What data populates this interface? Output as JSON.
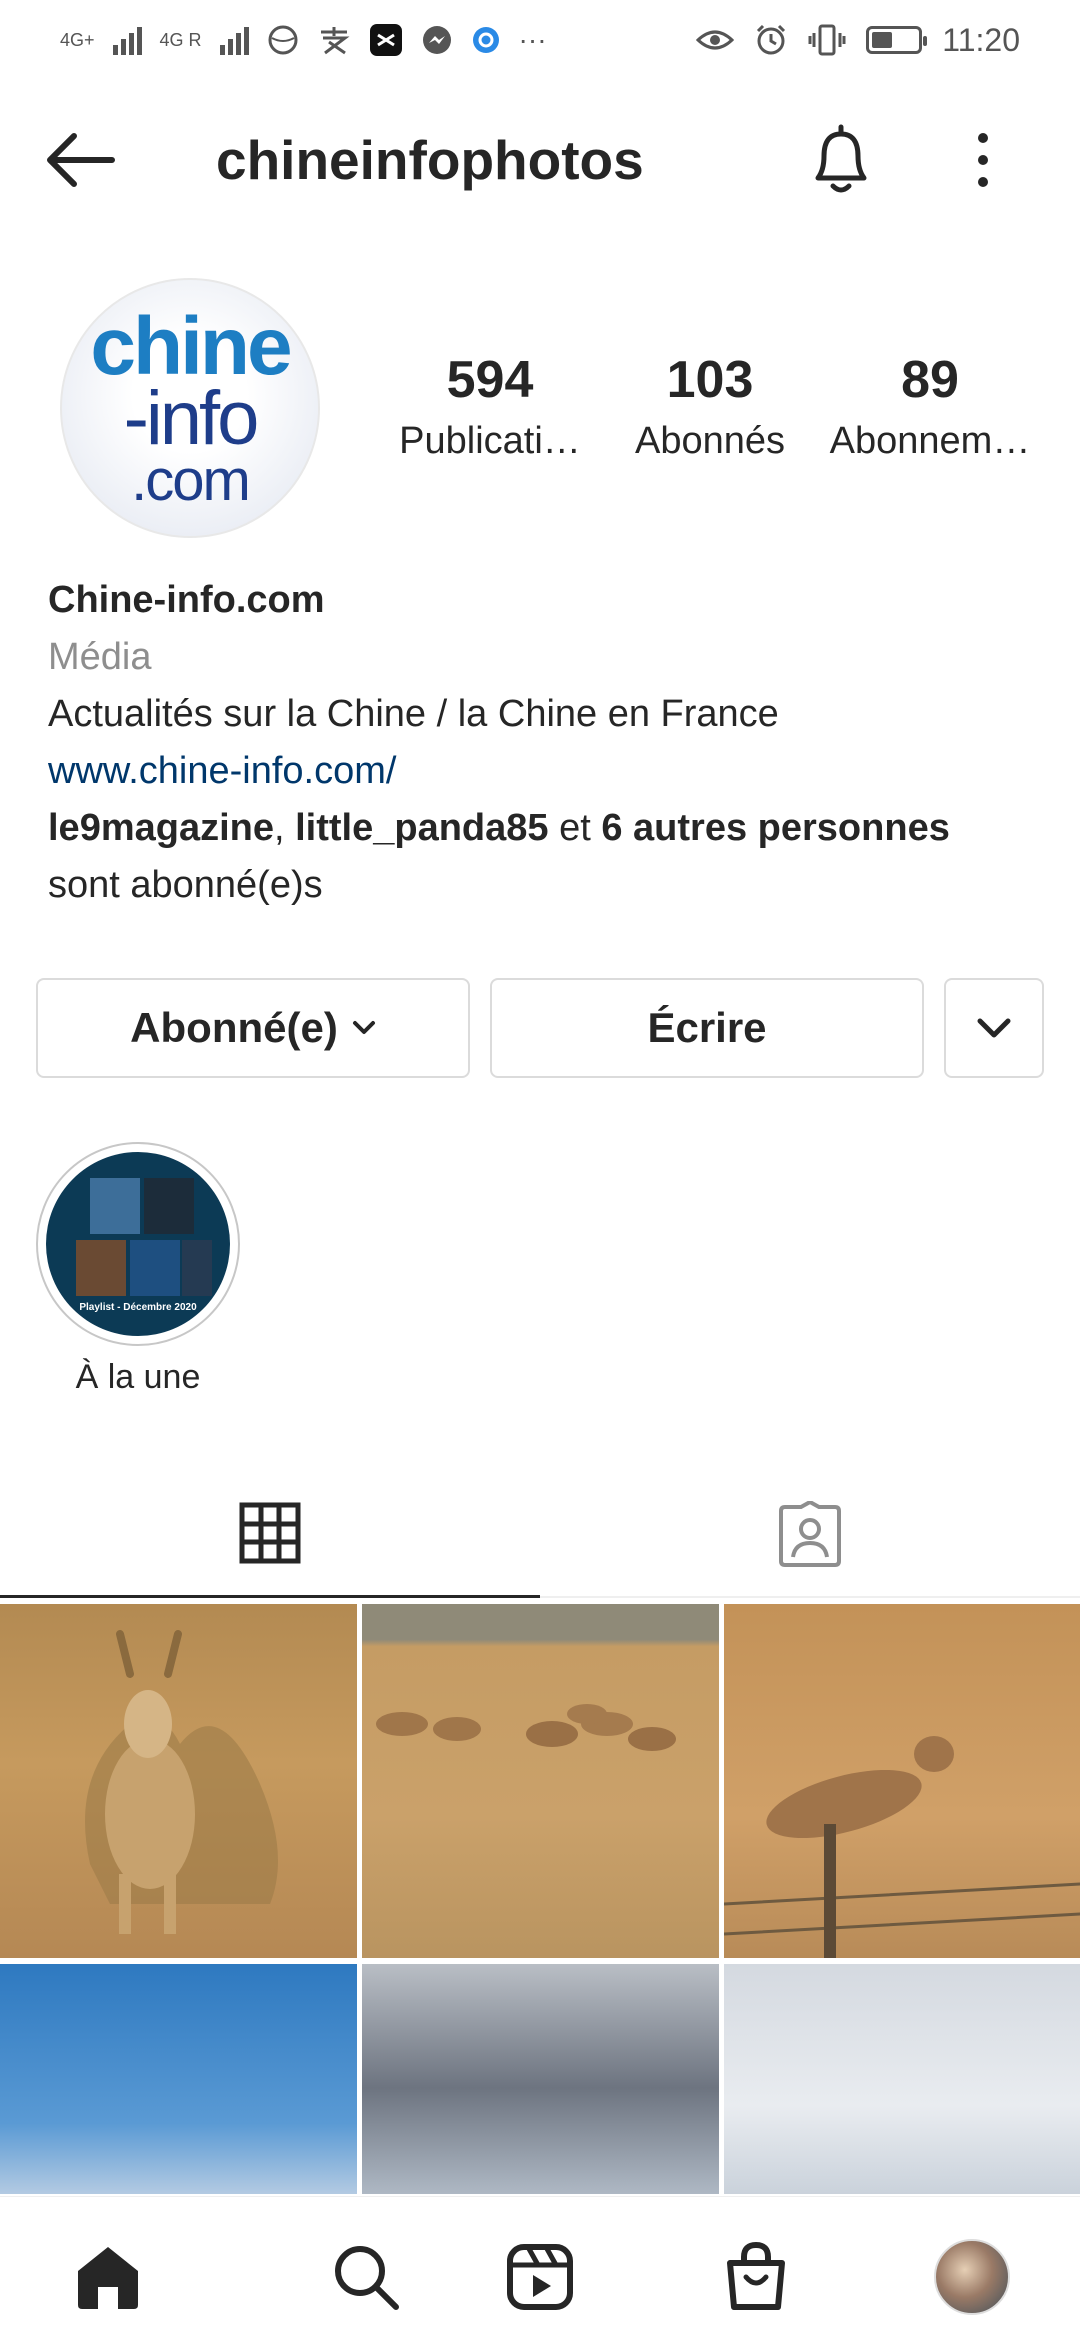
{
  "status_bar": {
    "network_1": "4G+",
    "network_2": "4G R",
    "more": "···",
    "battery_level": 0.45,
    "time": "11:20"
  },
  "header": {
    "username": "chineinfophotos"
  },
  "profile": {
    "avatar_lines": [
      "chine",
      "-info",
      ".com"
    ],
    "stats": [
      {
        "num": "594",
        "label": "Publicati…"
      },
      {
        "num": "103",
        "label": "Abonnés"
      },
      {
        "num": "89",
        "label": "Abonnem…"
      }
    ]
  },
  "bio": {
    "name": "Chine-info.com",
    "category": "Média",
    "description": "Actualités sur la Chine / la Chine en France",
    "link": "www.chine-info.com/",
    "followed_by_1": "le9magazine",
    "sep": ", ",
    "followed_by_2": "little_panda85",
    "and": " et ",
    "others": "6 autres personnes",
    "suffix": "sont abonné(e)s"
  },
  "buttons": {
    "follow": "Abonné(e)",
    "write": "Écrire"
  },
  "highlight": {
    "label": "À la une",
    "caption": "Playlist - Décembre 2020"
  },
  "colors": {
    "link": "#00376b",
    "muted": "#8e8e8e",
    "text": "#262626",
    "brand_blue": "#1d7ec3"
  },
  "icons": {
    "back": "arrow-left-icon",
    "bell": "bell-icon",
    "more": "vertical-dots-icon",
    "grid": "grid-icon",
    "tagged": "tagged-person-icon",
    "home": "home-icon",
    "search": "search-icon",
    "reels": "reels-icon",
    "shop": "shopping-bag-icon"
  }
}
